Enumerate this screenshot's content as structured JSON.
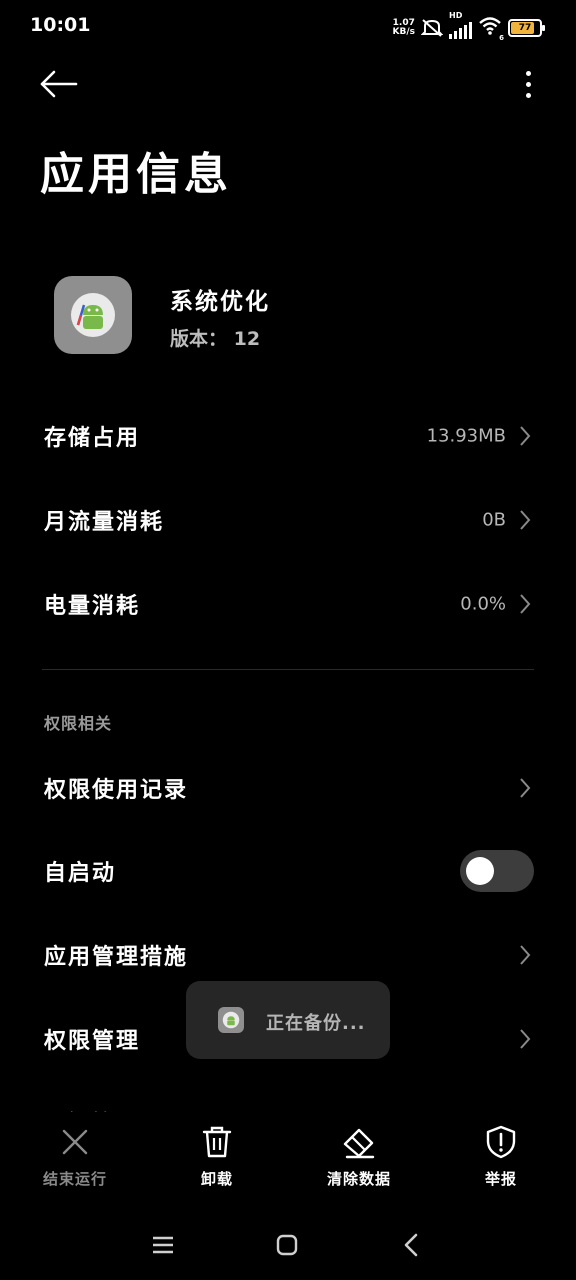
{
  "status_bar": {
    "time": "10:01",
    "net_speed_value": "1.07",
    "net_speed_unit": "KB/s",
    "hd_label": "HD",
    "wifi_label": "6",
    "battery_level": "77"
  },
  "header": {
    "title": "应用信息"
  },
  "app": {
    "name": "系统优化",
    "version": "版本： 12"
  },
  "rows": {
    "storage": {
      "label": "存储占用",
      "value": "13.93MB"
    },
    "traffic": {
      "label": "月流量消耗",
      "value": "0B"
    },
    "battery": {
      "label": "电量消耗",
      "value": "0.0%"
    }
  },
  "permissions": {
    "section_title": "权限相关",
    "usage_record": "权限使用记录",
    "autostart": "自启动",
    "autostart_on": false,
    "app_management": "应用管理措施",
    "permission_management": "权限管理",
    "cutoff_label": "通知管理"
  },
  "toast": {
    "text": "正在备份..."
  },
  "actions": {
    "force_stop": "结束运行",
    "uninstall": "卸载",
    "clear_data": "清除数据",
    "report": "举报"
  }
}
